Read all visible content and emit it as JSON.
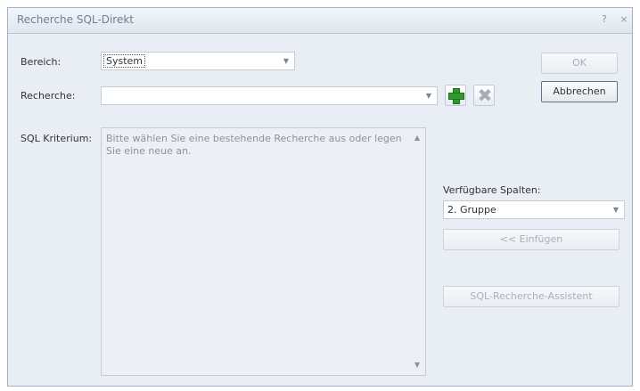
{
  "window": {
    "title": "Recherche SQL-Direkt",
    "help_glyph": "?",
    "close_glyph": "×"
  },
  "form": {
    "bereich_label": "Bereich:",
    "bereich_value": "System",
    "recherche_label": "Recherche:",
    "recherche_value": "",
    "sql_label": "SQL Kriterium:",
    "sql_text": "Bitte wählen Sie eine bestehende Recherche aus oder legen Sie eine neue an."
  },
  "buttons": {
    "ok": "OK",
    "cancel": "Abbrechen",
    "insert": "<< Einfügen",
    "assistant": "SQL-Recherche-Assistent"
  },
  "columns": {
    "label": "Verfügbare Spalten:",
    "selected": "2. Gruppe"
  },
  "icons": {
    "add": "add-green-plus-icon",
    "delete": "delete-gray-x-icon",
    "dropdown": "chevron-down-icon"
  }
}
